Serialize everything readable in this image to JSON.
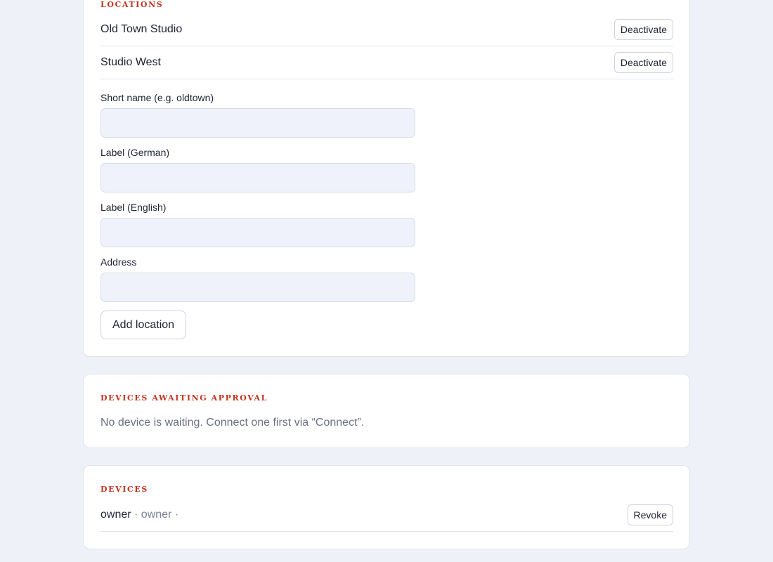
{
  "locations": {
    "section_title": "LOCATIONS",
    "items": [
      {
        "name": "Old Town Studio",
        "action_label": "Deactivate"
      },
      {
        "name": "Studio West",
        "action_label": "Deactivate"
      }
    ],
    "form": {
      "short_name_label": "Short name (e.g. oldtown)",
      "short_name_value": "",
      "label_de_label": "Label (German)",
      "label_de_value": "",
      "label_en_label": "Label (English)",
      "label_en_value": "",
      "address_label": "Address",
      "address_value": "",
      "submit_label": "Add location"
    }
  },
  "awaiting": {
    "section_title": "DEVICES AWAITING APPROVAL",
    "empty_text": "No device is waiting. Connect one first via “Connect”."
  },
  "devices": {
    "section_title": "DEVICES",
    "items": [
      {
        "name": "owner",
        "meta": " · owner ·",
        "action_label": "Revoke"
      }
    ]
  },
  "colors": {
    "accent": "#c4321f",
    "page_background": "#eef1f7",
    "input_background": "#eff2fb"
  }
}
